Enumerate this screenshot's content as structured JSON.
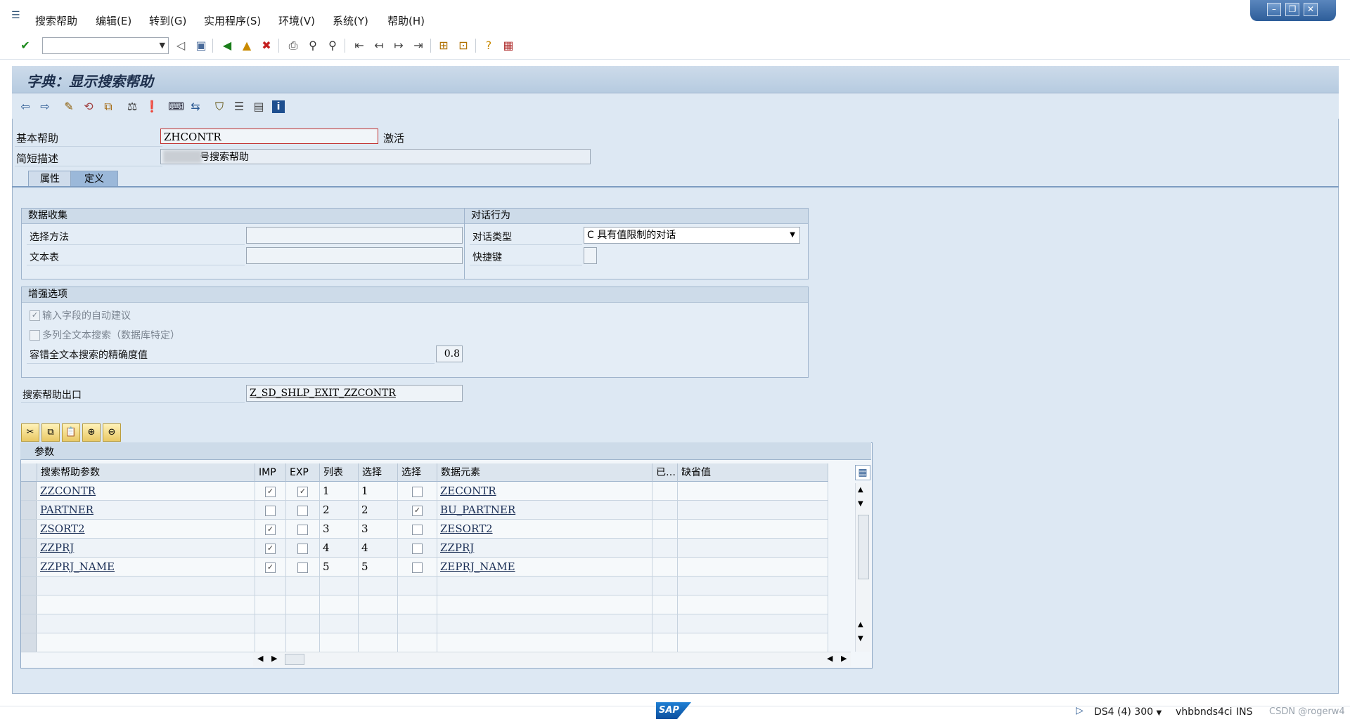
{
  "menubar": {
    "items": [
      "搜索帮助",
      "编辑(E)",
      "转到(G)",
      "实用程序(S)",
      "环境(V)",
      "系统(Y)",
      "帮助(H)"
    ]
  },
  "toolbar": {
    "command_value": ""
  },
  "screen": {
    "title": "字典：显示搜索帮助"
  },
  "header": {
    "basic_help_label": "基本帮助",
    "basic_help_value": "ZHCONTR",
    "status": "激活",
    "short_desc_label": "简短描述",
    "short_desc_value": "号搜索帮助"
  },
  "tabs": [
    {
      "label": "属性",
      "active": false
    },
    {
      "label": "定义",
      "active": true
    }
  ],
  "data_collection": {
    "title": "数据收集",
    "method_label": "选择方法",
    "method_value": "",
    "text_table_label": "文本表",
    "text_table_value": ""
  },
  "dialog_behavior": {
    "title": "对话行为",
    "type_label": "对话类型",
    "type_value": "C 具有值限制的对话",
    "hotkey_label": "快捷键",
    "hotkey_value": ""
  },
  "enhanced": {
    "title": "增强选项",
    "auto_suggest_label": "输入字段的自动建议",
    "auto_suggest_checked": true,
    "fulltext_label": "多列全文本搜索（数据库特定）",
    "fulltext_checked": false,
    "accuracy_label": "容错全文本搜索的精确度值",
    "accuracy_value": "0.8"
  },
  "exit": {
    "label": "搜索帮助出口",
    "value": "Z_SD_SHLP_EXIT_ZZCONTR"
  },
  "params_table": {
    "caption": "参数",
    "columns": [
      "搜索帮助参数",
      "IMP",
      "EXP",
      "列表",
      "选择",
      "选择",
      "数据元素",
      "已…",
      "缺省值"
    ],
    "rows": [
      {
        "param": "ZZCONTR",
        "imp": true,
        "exp": true,
        "lpos": "1",
        "spos": "1",
        "sdis": false,
        "elem": "ZECONTR",
        "mod": "",
        "default": ""
      },
      {
        "param": "PARTNER",
        "imp": false,
        "exp": false,
        "lpos": "2",
        "spos": "2",
        "sdis": true,
        "elem": "BU_PARTNER",
        "mod": "",
        "default": ""
      },
      {
        "param": "ZSORT2",
        "imp": true,
        "exp": false,
        "lpos": "3",
        "spos": "3",
        "sdis": false,
        "elem": "ZESORT2",
        "mod": "",
        "default": ""
      },
      {
        "param": "ZZPRJ",
        "imp": true,
        "exp": false,
        "lpos": "4",
        "spos": "4",
        "sdis": false,
        "elem": "ZZPRJ",
        "mod": "",
        "default": ""
      },
      {
        "param": "ZZPRJ_NAME",
        "imp": true,
        "exp": false,
        "lpos": "5",
        "spos": "5",
        "sdis": false,
        "elem": "ZEPRJ_NAME",
        "mod": "",
        "default": ""
      }
    ],
    "empty_rows": 4
  },
  "statusbar": {
    "system": "DS4 (4) 300",
    "host": "vhbbnds4ci",
    "mode": "INS",
    "watermark": "CSDN @rogerw4"
  },
  "colors": {
    "accent": "#2d5b93",
    "frame": "#dde8f3",
    "header": "#cddbe9"
  }
}
